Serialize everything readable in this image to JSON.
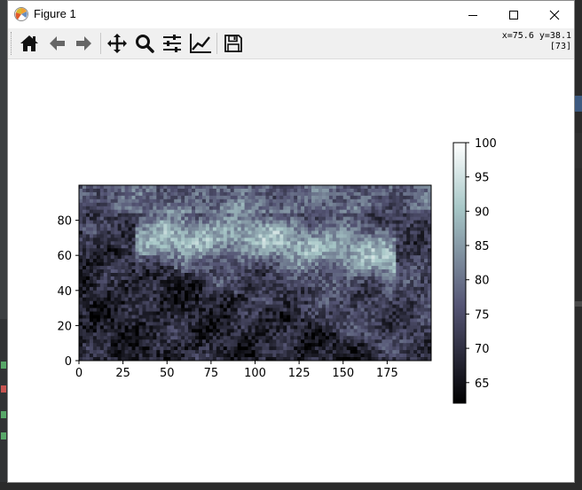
{
  "window": {
    "title": "Figure 1"
  },
  "toolbar": {
    "tools": [
      {
        "name": "home-icon",
        "tooltip": "Home"
      },
      {
        "name": "back-icon",
        "tooltip": "Back"
      },
      {
        "name": "forward-icon",
        "tooltip": "Forward"
      },
      {
        "name": "pan-icon",
        "tooltip": "Pan"
      },
      {
        "name": "zoom-icon",
        "tooltip": "Zoom"
      },
      {
        "name": "configure-subplots-icon",
        "tooltip": "Subplots"
      },
      {
        "name": "edit-axis-icon",
        "tooltip": "Customize"
      },
      {
        "name": "save-icon",
        "tooltip": "Save"
      }
    ],
    "coord_line1": "x=75.6 y=38.1",
    "coord_line2": "[73]"
  },
  "chart_data": [
    {
      "type": "heatmap",
      "title": "",
      "xlabel": "",
      "ylabel": "",
      "xlim": [
        0,
        200
      ],
      "ylim": [
        0,
        100
      ],
      "x_ticks": [
        "0",
        "25",
        "50",
        "75",
        "100",
        "125",
        "150",
        "175"
      ],
      "y_ticks": [
        "0",
        "20",
        "40",
        "60",
        "80"
      ],
      "colormap": "bone",
      "value_range": [
        62,
        100
      ],
      "grid": false
    },
    {
      "type": "colorbar",
      "ticks": [
        "65",
        "70",
        "75",
        "80",
        "85",
        "90",
        "95",
        "100"
      ],
      "range": [
        62,
        100
      ],
      "colormap": "bone"
    }
  ]
}
